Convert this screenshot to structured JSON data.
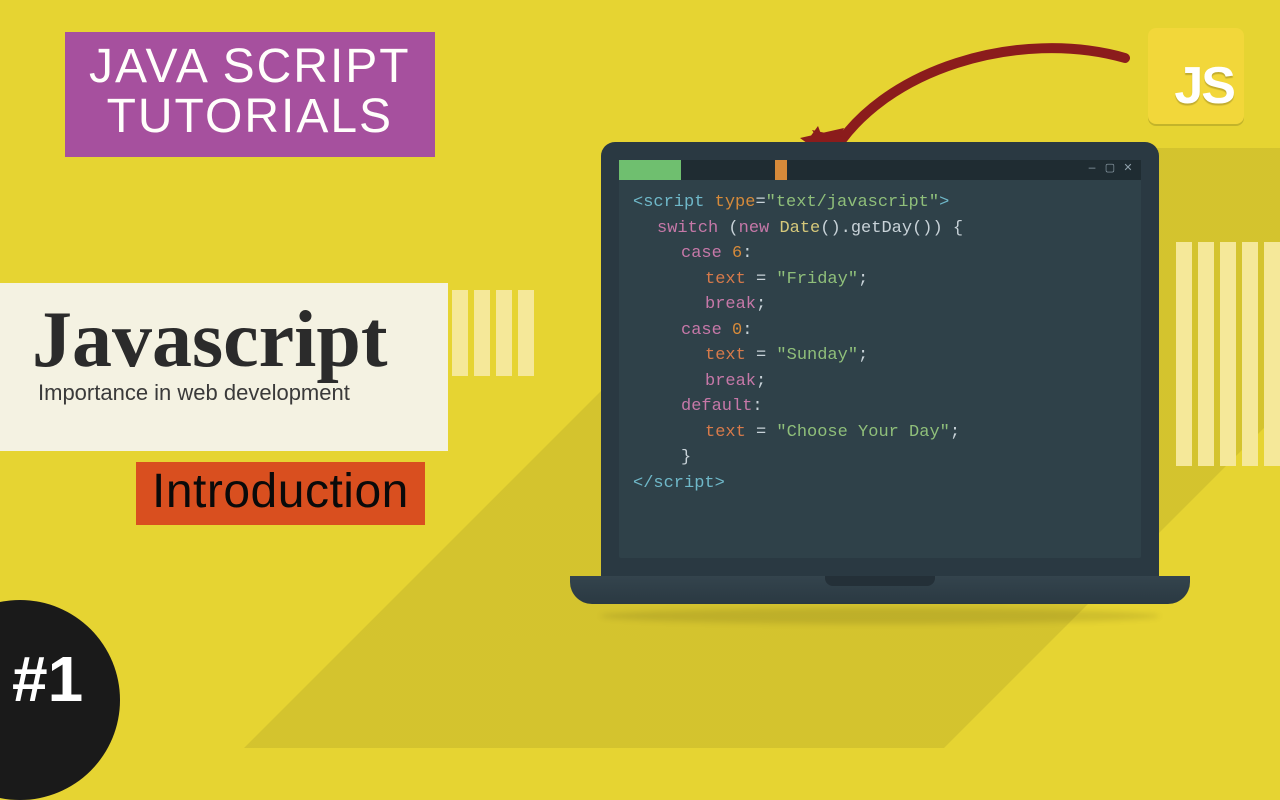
{
  "header": {
    "line1": "JAVA SCRIPT",
    "line2": "TUTORIALS"
  },
  "logo": {
    "text": "JS"
  },
  "titleCard": {
    "title": "Javascript",
    "subtitle": "Importance in web development"
  },
  "introLabel": "Introduction",
  "episode": "#1",
  "winctrl": {
    "min": "—",
    "max": "▢",
    "close": "✕"
  },
  "code": {
    "l1a": "<script ",
    "l1b": "type",
    "l1c": "=",
    "l1d": "\"text/javascript\"",
    "l1e": ">",
    "l2a": "switch ",
    "l2b": "(",
    "l2c": "new ",
    "l2d": "Date",
    "l2e": "().getDay()) {",
    "l3a": "case ",
    "l3b": "6",
    "l3c": ":",
    "l4a": "text",
    "l4b": " = ",
    "l4c": "\"Friday\"",
    "l4d": ";",
    "l5a": "break",
    "l5b": ";",
    "l6a": "case ",
    "l6b": "0",
    "l6c": ":",
    "l7a": "text",
    "l7b": " = ",
    "l7c": "\"Sunday\"",
    "l7d": ";",
    "l8a": "break",
    "l8b": ";",
    "l9a": "default",
    "l9b": ":",
    "l10a": "text",
    "l10b": " = ",
    "l10c": "\"Choose Your Day\"",
    "l10d": ";",
    "l11": "}",
    "l12": "</script>"
  }
}
